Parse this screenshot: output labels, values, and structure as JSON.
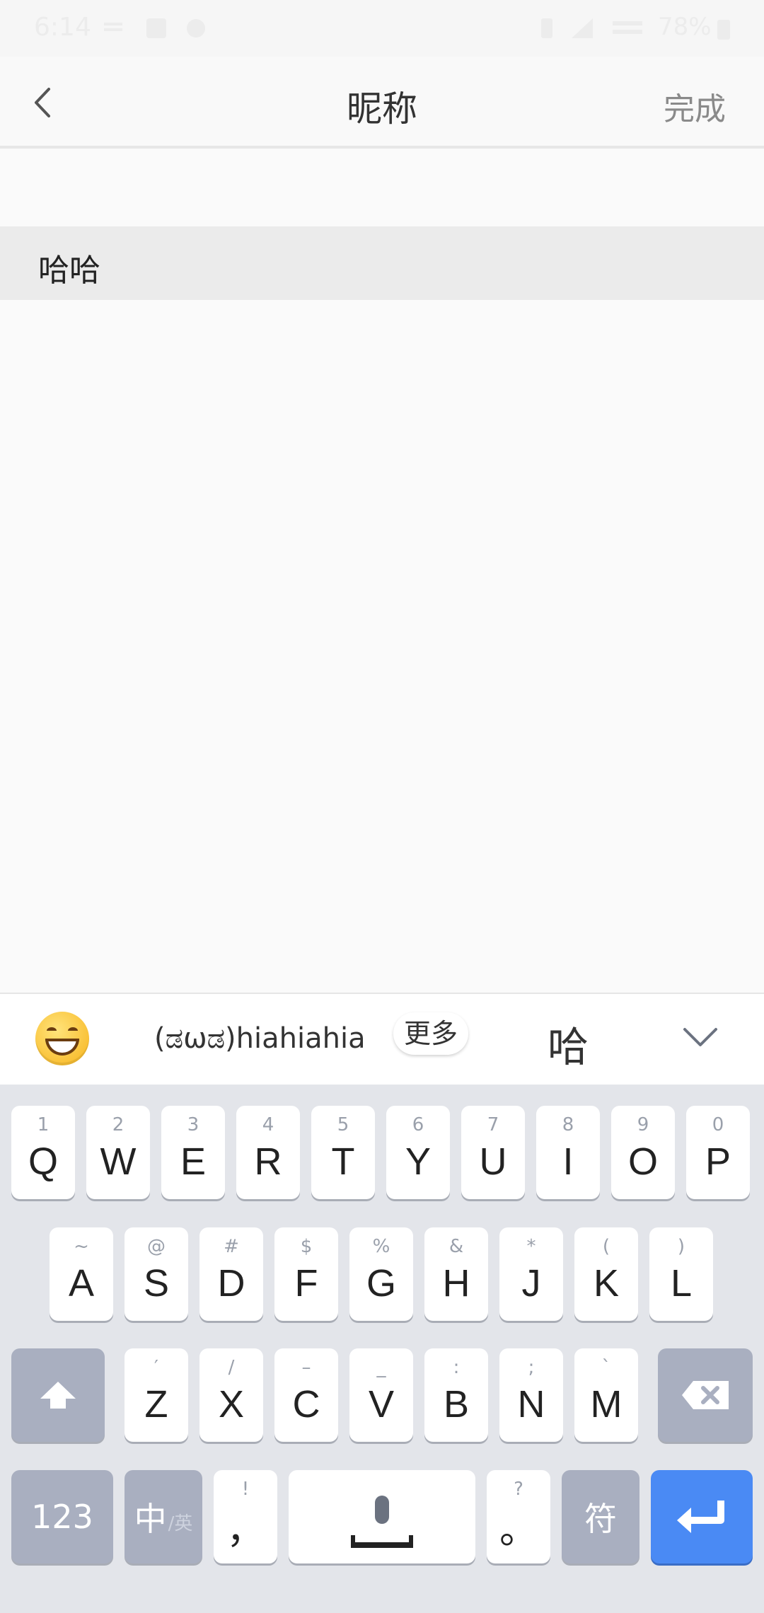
{
  "status_bar": {
    "time": "6:14",
    "battery": "78%"
  },
  "navbar": {
    "title": "昵称",
    "done_label": "完成"
  },
  "nickname_input": {
    "value": "哈哈"
  },
  "candidates": {
    "items": [
      "(ಡωಡ)hiahiahia",
      "哈"
    ],
    "more_label": "更多"
  },
  "keyboard": {
    "row1": [
      {
        "sub": "1",
        "main": "Q"
      },
      {
        "sub": "2",
        "main": "W"
      },
      {
        "sub": "3",
        "main": "E"
      },
      {
        "sub": "4",
        "main": "R"
      },
      {
        "sub": "5",
        "main": "T"
      },
      {
        "sub": "6",
        "main": "Y"
      },
      {
        "sub": "7",
        "main": "U"
      },
      {
        "sub": "8",
        "main": "I"
      },
      {
        "sub": "9",
        "main": "O"
      },
      {
        "sub": "0",
        "main": "P"
      }
    ],
    "row2": [
      {
        "sub": "~",
        "main": "A"
      },
      {
        "sub": "@",
        "main": "S"
      },
      {
        "sub": "#",
        "main": "D"
      },
      {
        "sub": "$",
        "main": "F"
      },
      {
        "sub": "%",
        "main": "G"
      },
      {
        "sub": "&",
        "main": "H"
      },
      {
        "sub": "*",
        "main": "J"
      },
      {
        "sub": "(",
        "main": "K"
      },
      {
        "sub": ")",
        "main": "L"
      }
    ],
    "row3": [
      {
        "sub": "′",
        "main": "Z"
      },
      {
        "sub": "/",
        "main": "X"
      },
      {
        "sub": "–",
        "main": "C"
      },
      {
        "sub": "_",
        "main": "V"
      },
      {
        "sub": ":",
        "main": "B"
      },
      {
        "sub": ";",
        "main": "N"
      },
      {
        "sub": "`",
        "main": "M"
      }
    ],
    "row4": {
      "numbers_label": "123",
      "lang_label_main": "中",
      "lang_label_sub": "/英",
      "comma_sub": "!",
      "comma_main": "，",
      "period_sub": "?",
      "period_main": "。",
      "symbols_label": "符"
    }
  }
}
